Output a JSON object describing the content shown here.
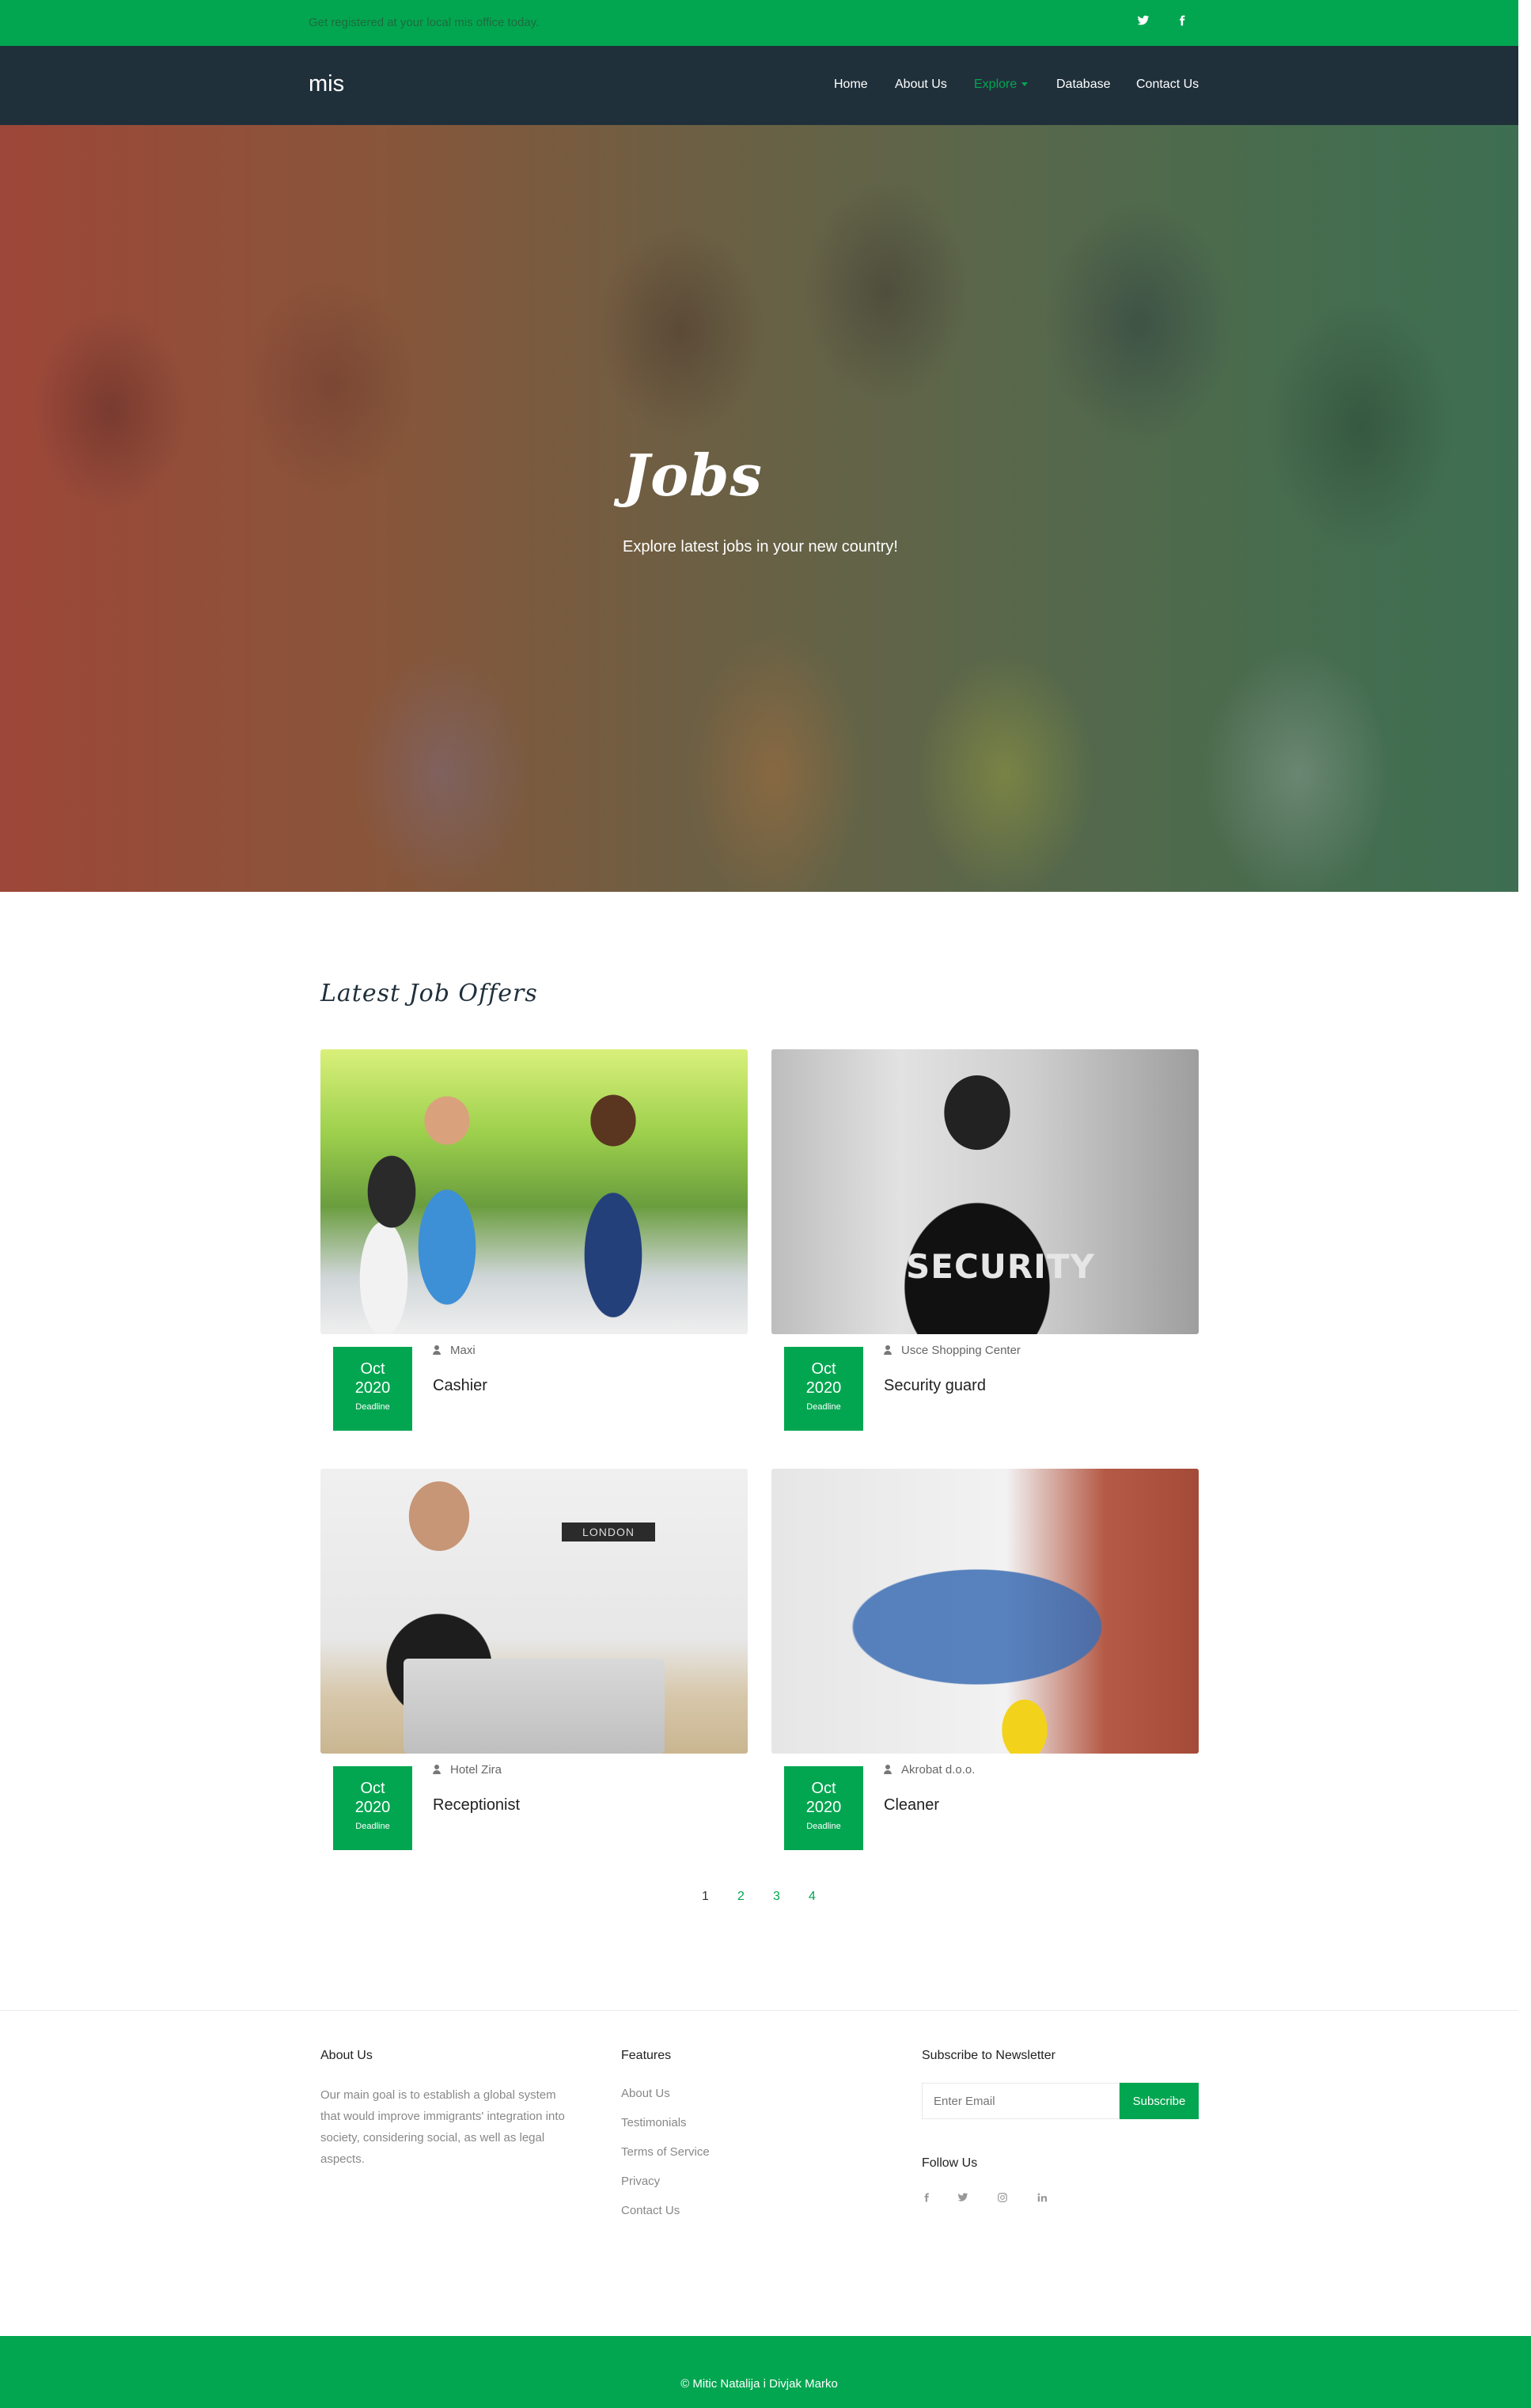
{
  "topbar": {
    "message": "Get registered at your local mis office today.",
    "icons": [
      "twitter-icon",
      "facebook-icon"
    ]
  },
  "nav": {
    "brand": "mis",
    "links": [
      {
        "label": "Home"
      },
      {
        "label": "About Us"
      },
      {
        "label": "Explore",
        "active": true
      },
      {
        "label": "Database"
      },
      {
        "label": "Contact Us"
      }
    ]
  },
  "hero": {
    "title": "Jobs",
    "subtitle": "Explore latest jobs in your new country!"
  },
  "jobs_section": {
    "title": "Latest Job Offers",
    "jobs": [
      {
        "month": "Oct",
        "year": "2020",
        "deadline_label": "Deadline",
        "company": "Maxi",
        "title": "Cashier"
      },
      {
        "month": "Oct",
        "year": "2020",
        "deadline_label": "Deadline",
        "company": "Usce Shopping Center",
        "title": "Security guard",
        "image_text": "SECURITY"
      },
      {
        "month": "Oct",
        "year": "2020",
        "deadline_label": "Deadline",
        "company": "Hotel Zira",
        "title": "Receptionist",
        "image_text": "LONDON"
      },
      {
        "month": "Oct",
        "year": "2020",
        "deadline_label": "Deadline",
        "company": "Akrobat d.o.o.",
        "title": "Cleaner"
      }
    ]
  },
  "pagination": {
    "pages": [
      "1",
      "2",
      "3",
      "4"
    ],
    "current": "1"
  },
  "footer": {
    "about": {
      "heading": "About Us",
      "text": "Our main goal is to establish a global system that would improve immigrants' integration into society, considering social, as well as legal aspects."
    },
    "features": {
      "heading": "Features",
      "links": [
        "About Us",
        "Testimonials",
        "Terms of Service",
        "Privacy",
        "Contact Us"
      ]
    },
    "newsletter": {
      "heading": "Subscribe to Newsletter",
      "email_placeholder": "Enter Email",
      "button_label": "Subscribe"
    },
    "follow": {
      "heading": "Follow Us",
      "icons": [
        "facebook-icon",
        "twitter-icon",
        "instagram-icon",
        "linkedin-icon"
      ]
    }
  },
  "bottom": {
    "copyright": "© Mitic Natalija i Divjak Marko"
  },
  "colors": {
    "accent": "#02a650",
    "nav_bg": "#20303b"
  }
}
